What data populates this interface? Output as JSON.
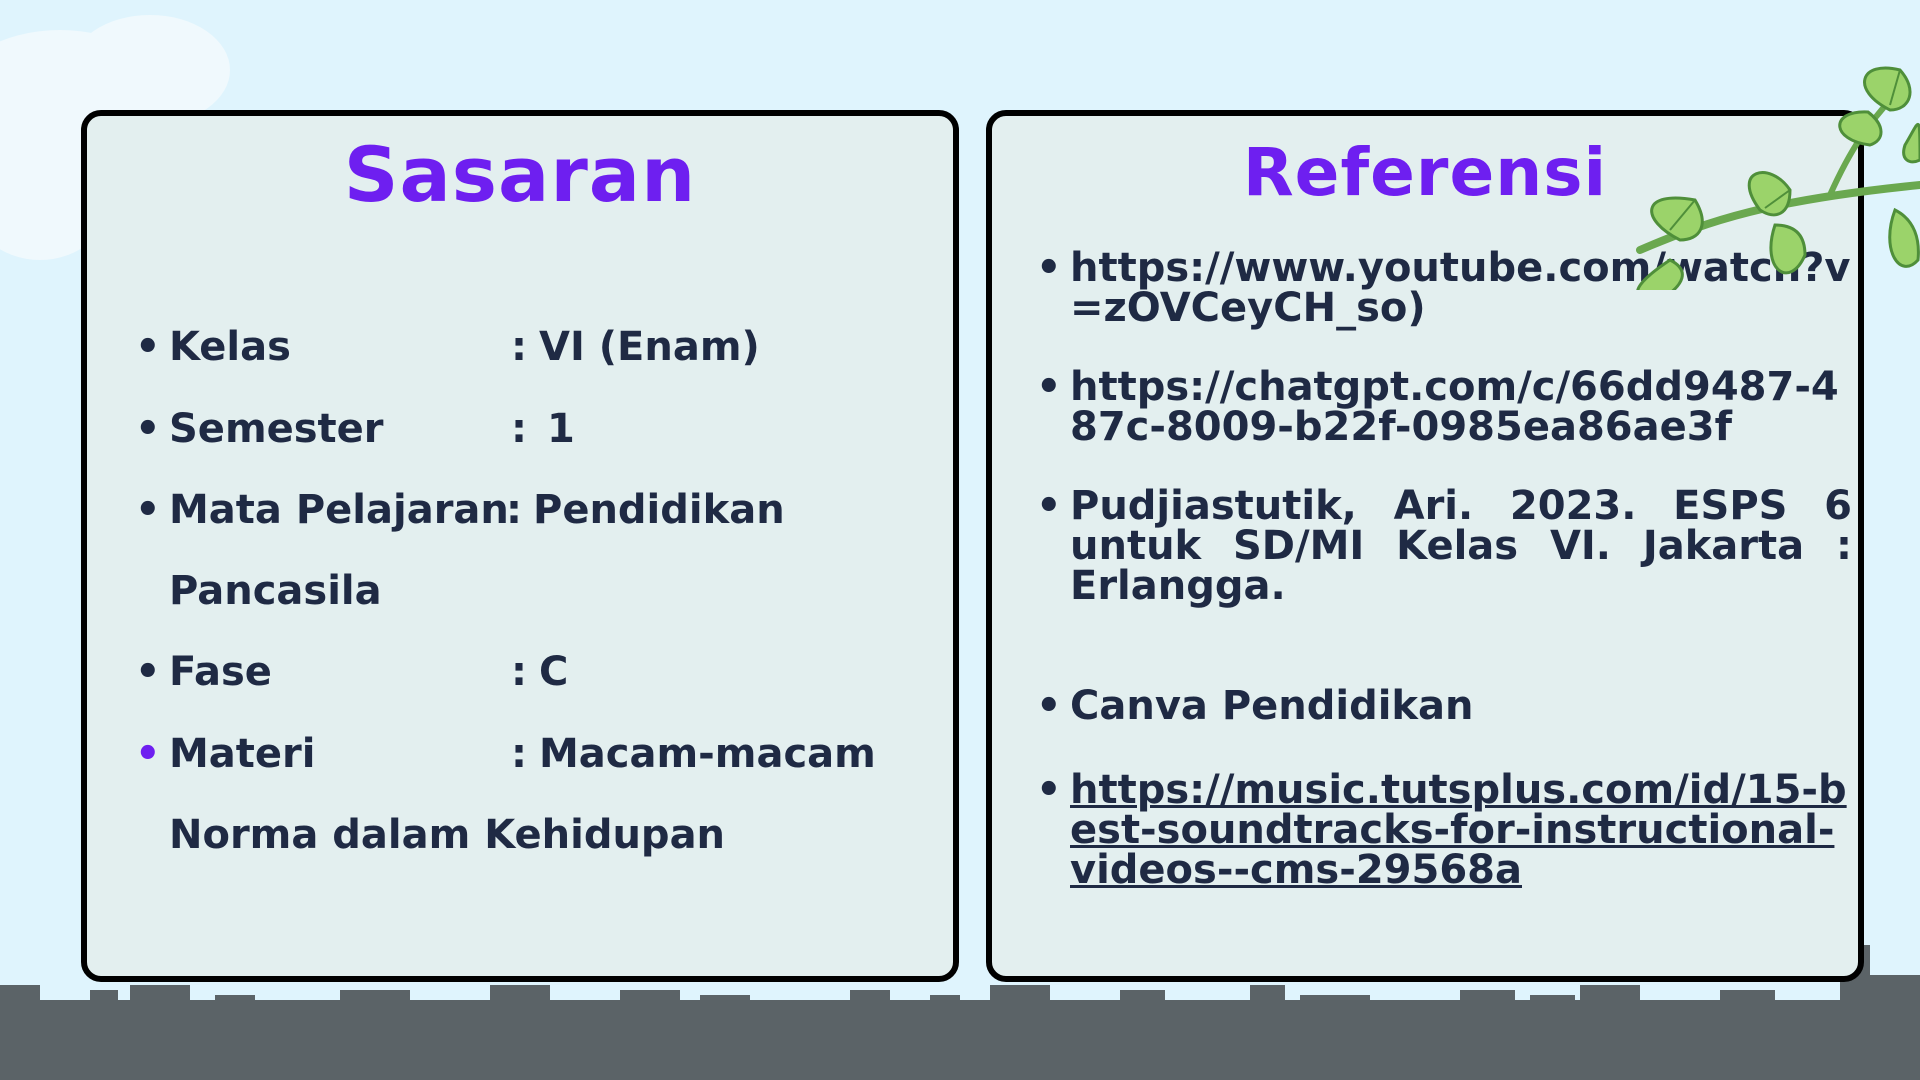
{
  "colors": {
    "sky": "#dff4fd",
    "card_bg": "#e3efef",
    "card_border": "#000000",
    "title": "#6e1ff0",
    "text": "#1f2a44",
    "skyline": "#5b6367",
    "leaf": "#9bd36a",
    "leaf_dark": "#4f8f3a"
  },
  "left_card": {
    "title": "Sasaran",
    "items": [
      {
        "bullet": "•",
        "label": "Kelas",
        "sep": ":",
        "value": "VI (Enam)"
      },
      {
        "bullet": "•",
        "label": "Semester",
        "sep": ":",
        "value": "1"
      },
      {
        "bullet": "•",
        "label": "Mata Pelajaran",
        "sep": ":",
        "value": "Pendidikan",
        "cont": "Pancasila"
      },
      {
        "bullet": "•",
        "label": "Fase",
        "sep": ":",
        "value": "C"
      },
      {
        "bullet": "•",
        "label": "Materi",
        "sep": ":",
        "value": "Macam-macam",
        "cont": "Norma dalam Kehidupan"
      }
    ]
  },
  "right_card": {
    "title": "Referensi",
    "items": [
      {
        "bullet": "•",
        "text": "https://www.youtube.com/watch?v=zOVCeyCH_so)"
      },
      {
        "bullet": "•",
        "text": "https://chatgpt.com/c/66dd9487-487c-8009-b22f-0985ea86ae3f"
      },
      {
        "bullet": "•",
        "text": "Pudjiastutik, Ari. 2023. ESPS 6 untuk SD/MI Kelas VI. Jakarta : Erlangga."
      },
      {
        "bullet": "•",
        "text": "Canva Pendidikan"
      },
      {
        "bullet": "•",
        "text": "https://music.tutsplus.com/id/15-best-soundtracks-for-instructional-videos--cms-29568a"
      }
    ]
  },
  "icons": {
    "leaf_branch": "leaf-branch-icon",
    "skyline": "city-skyline-icon",
    "cloud": "cloud-icon"
  }
}
